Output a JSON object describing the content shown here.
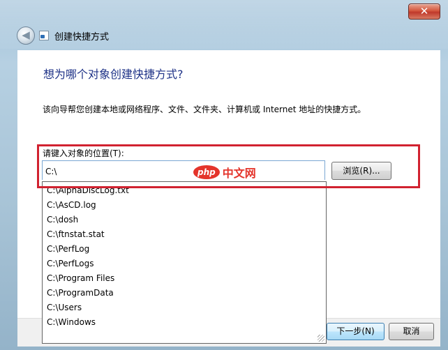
{
  "window": {
    "close_label": "✕",
    "back_label": "◀",
    "title": "创建快捷方式"
  },
  "page": {
    "heading": "想为哪个对象创建快捷方式?",
    "description": "该向导帮您创建本地或网络程序、文件、文件夹、计算机或 Internet 地址的快捷方式。",
    "field_label": "请键入对象的位置(T):",
    "location_value": "C:\\",
    "browse_label": "浏览(R)..."
  },
  "autocomplete": {
    "items": [
      "C:\\AlphaDiscLog.txt",
      "C:\\AsCD.log",
      "C:\\dosh",
      "C:\\ftnstat.stat",
      "C:\\PerfLog",
      "C:\\PerfLogs",
      "C:\\Program Files",
      "C:\\ProgramData",
      "C:\\Users",
      "C:\\Windows"
    ]
  },
  "footer": {
    "next_label": "下一步(N)",
    "cancel_label": "取消"
  },
  "watermark": {
    "logo": "php",
    "text": "中文网"
  },
  "colors": {
    "heading": "#1e3287",
    "highlight_border": "#d12230",
    "close_button": "#c0392b"
  }
}
